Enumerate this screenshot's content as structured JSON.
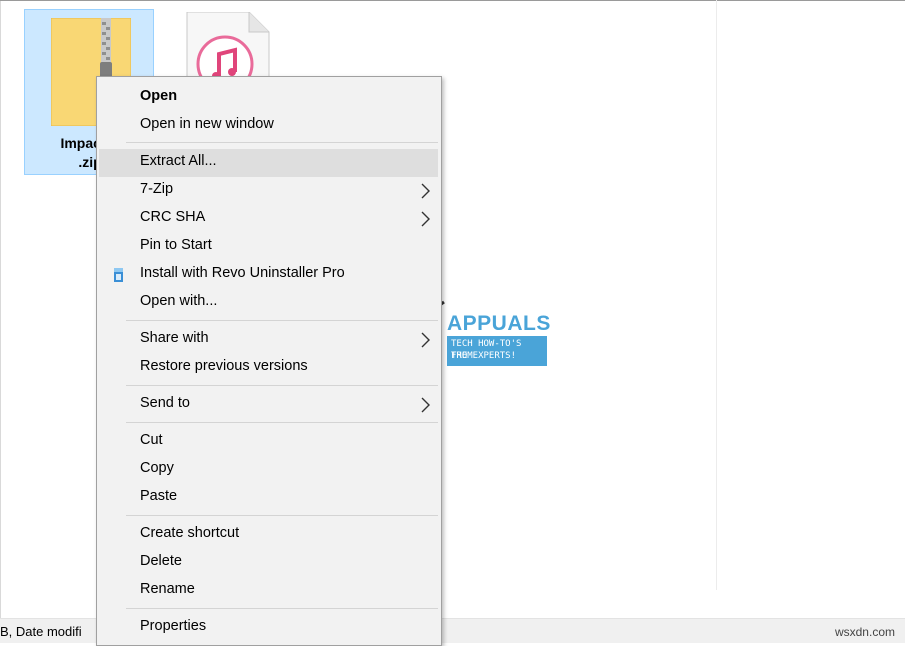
{
  "file_selected": {
    "name_line1": "Impactor",
    "name_line2": ".zip",
    "icon": "zip-folder-icon"
  },
  "file_other": {
    "icon": "itunes-file-icon"
  },
  "status_bar": {
    "text": "B, Date modifi"
  },
  "watermark": {
    "brand": "APPUALS",
    "tagline_line1": "TECH HOW-TO'S FROM",
    "tagline_line2": "THE EXPERTS!",
    "site": "wsxdn.com"
  },
  "context_menu": {
    "items": [
      {
        "label": "Open",
        "bold": true
      },
      {
        "label": "Open in new window"
      },
      {
        "label": "Extract All...",
        "highlighted": true
      },
      {
        "label": "7-Zip",
        "submenu": true
      },
      {
        "label": "CRC SHA",
        "submenu": true
      },
      {
        "label": "Pin to Start"
      },
      {
        "label": "Install with Revo Uninstaller Pro",
        "icon": "revo-uninstaller-icon"
      },
      {
        "label": "Open with..."
      },
      {
        "label": "Share with",
        "submenu": true
      },
      {
        "label": "Restore previous versions"
      },
      {
        "label": "Send to",
        "submenu": true
      },
      {
        "label": "Cut"
      },
      {
        "label": "Copy"
      },
      {
        "label": "Paste"
      },
      {
        "label": "Create shortcut"
      },
      {
        "label": "Delete"
      },
      {
        "label": "Rename"
      },
      {
        "label": "Properties"
      }
    ]
  }
}
